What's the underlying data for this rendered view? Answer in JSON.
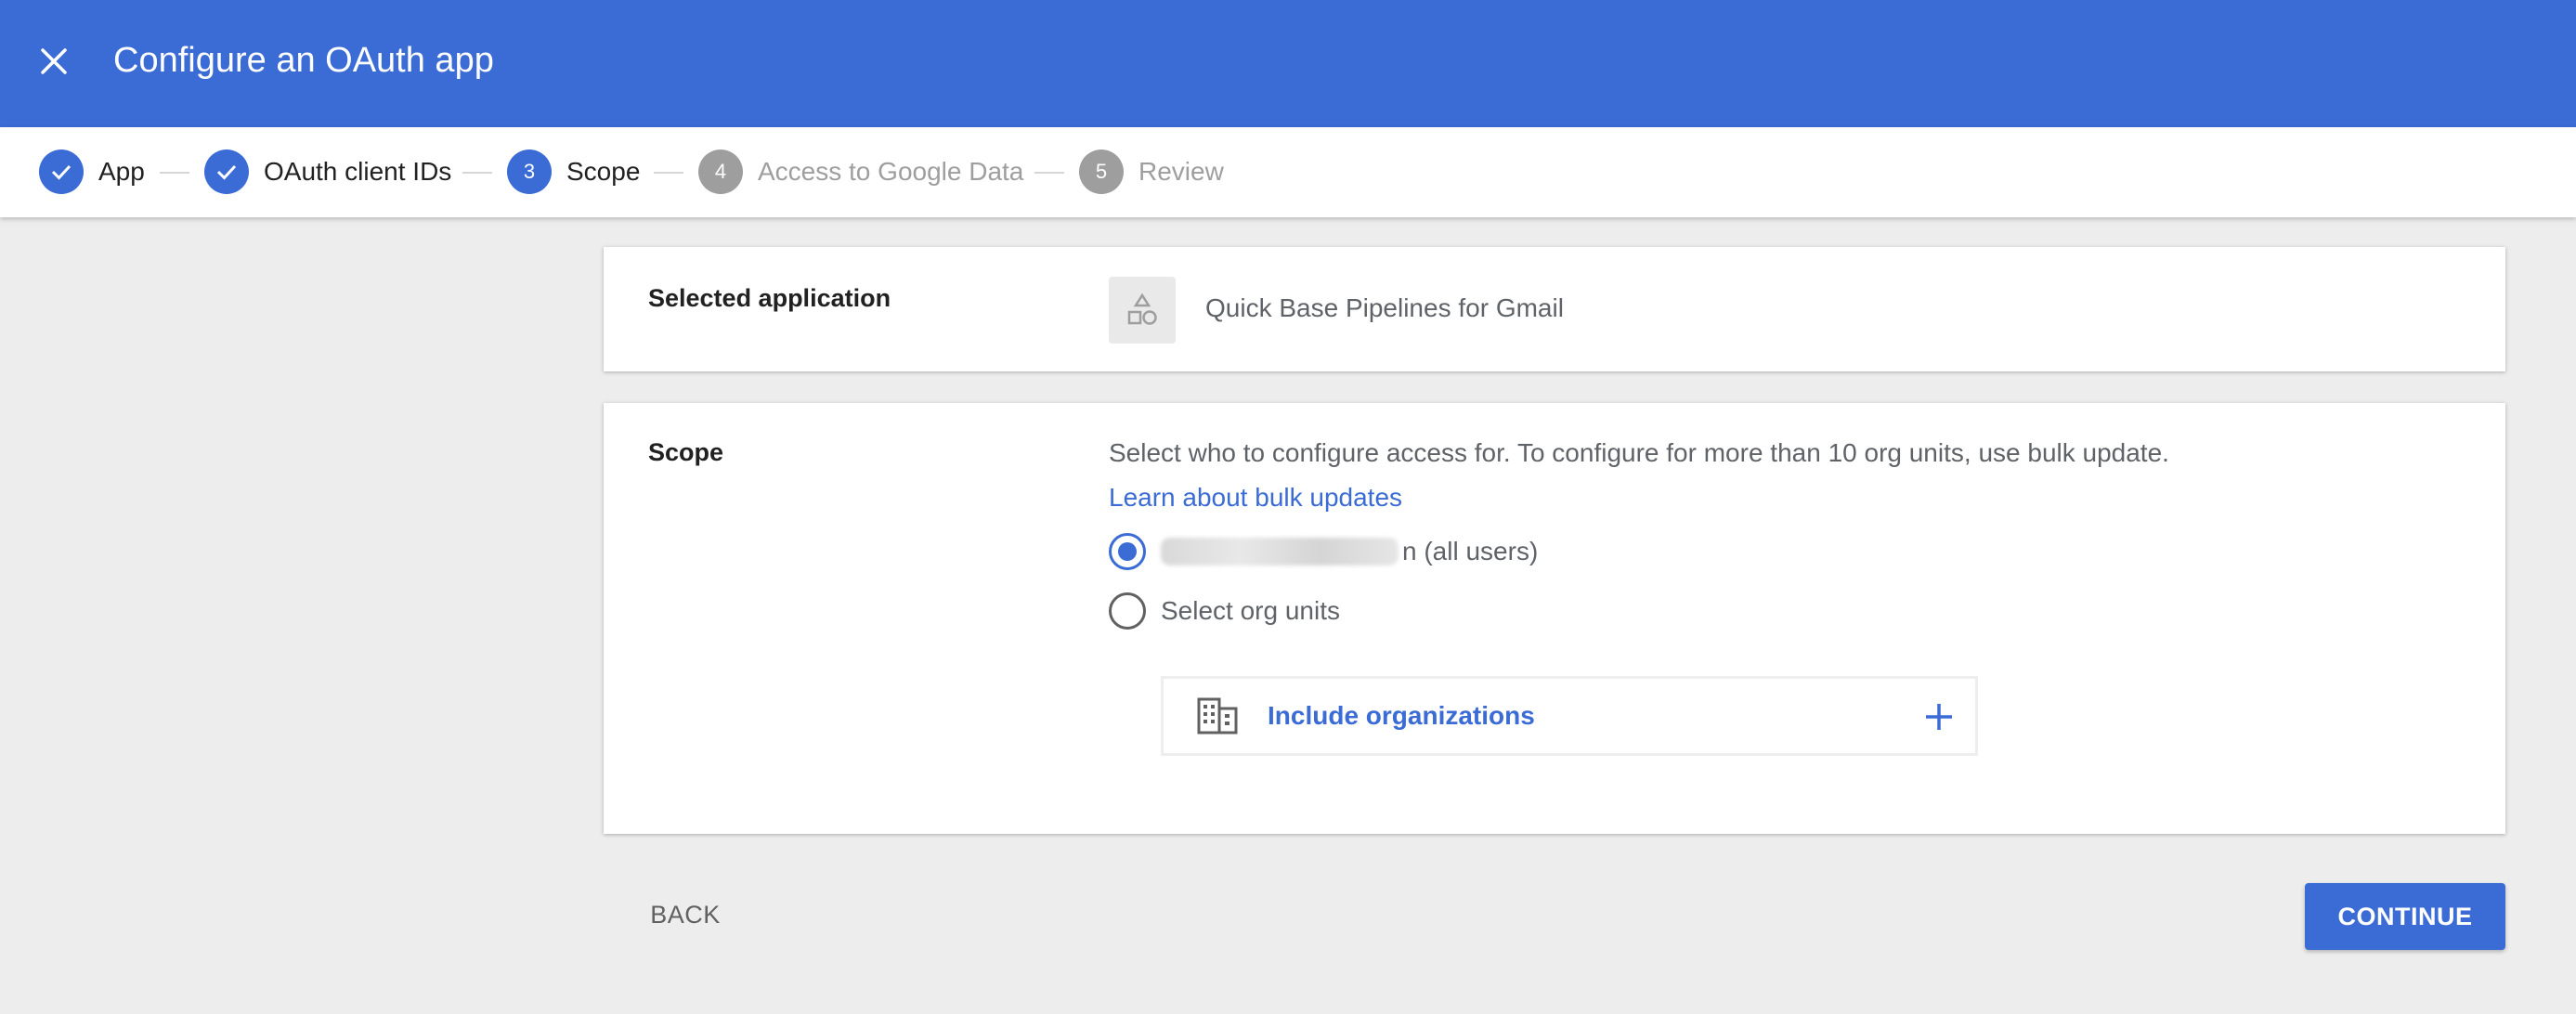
{
  "header": {
    "title": "Configure an OAuth app",
    "close_icon": "close-icon"
  },
  "stepper": {
    "steps": [
      {
        "number": "1",
        "label": "App",
        "status": "done"
      },
      {
        "number": "2",
        "label": "OAuth client IDs",
        "status": "done"
      },
      {
        "number": "3",
        "label": "Scope",
        "status": "active"
      },
      {
        "number": "4",
        "label": "Access to Google Data",
        "status": "todo"
      },
      {
        "number": "5",
        "label": "Review",
        "status": "todo"
      }
    ]
  },
  "selected_app": {
    "label": "Selected application",
    "app_name": "Quick Base Pipelines for Gmail",
    "icon": "app-shapes-icon"
  },
  "scope": {
    "label": "Scope",
    "description": "Select who to configure access for. To configure for more than 10 org units, use bulk update.",
    "link": "Learn about bulk updates",
    "options": [
      {
        "label_suffix": "n (all users)",
        "checked": true
      },
      {
        "label": "Select org units",
        "checked": false
      }
    ],
    "include_label": "Include organizations"
  },
  "footer": {
    "back_label": "BACK",
    "continue_label": "CONTINUE"
  },
  "colors": {
    "primary": "#3b6bd4",
    "inactive_step": "#9e9e9e",
    "background": "#ededed"
  }
}
